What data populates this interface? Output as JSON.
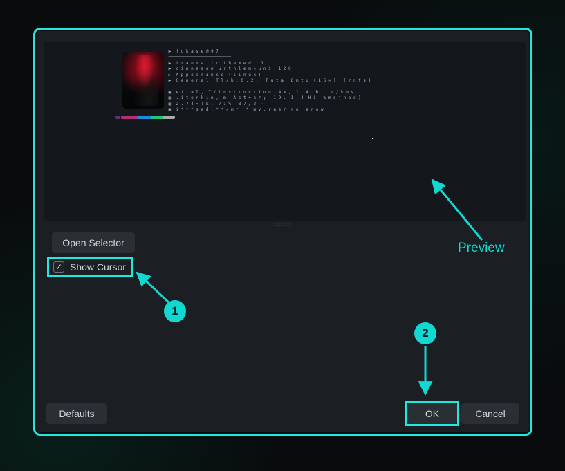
{
  "buttons": {
    "open_selector": "Open Selector",
    "defaults": "Defaults",
    "ok": "OK",
    "cancel": "Cancel"
  },
  "checkbox": {
    "show_cursor_label": "Show Cursor",
    "checked_glyph": "✓"
  },
  "annotations": {
    "preview_label": "Preview",
    "step1": "1",
    "step2": "2"
  },
  "preview": {
    "neofetch_lines": "                   ▶  f u k a s e @ 9 7\n                   ─────────────────────────\n                   ▶  t r a u m a t i c  t h e m e d  r 1\n                   ▶  c i n n a m o n  u r t n l e m « u n i   1 2 0\n                   ▶  A p p e a r a n c e  ( l i n u x )\n                   ▶  G e n e r a l   T l / b : 0 . 2 ,   P u t a   O m t u  ( 1 6 × )   ( r n f s )\n\n                   ▣  e t . a l ,  7 / i n s t r u c t i o n   4 × ,  1 . 4   h t   ✂ / k m s\n                   ▣  . i t e r k i n ,  m   A c t + o r ;   1 9 .  1 . 4  H i   % m s j n e d )\n                   ▣  2 . 7 4 ≈ l k ,  7 1 %   8 7 / 2  ·\n                   ▣  i * * * s a d . * * » m *   *  m v . r a e r  r e   a r o w",
    "grip": "::::::::::"
  }
}
